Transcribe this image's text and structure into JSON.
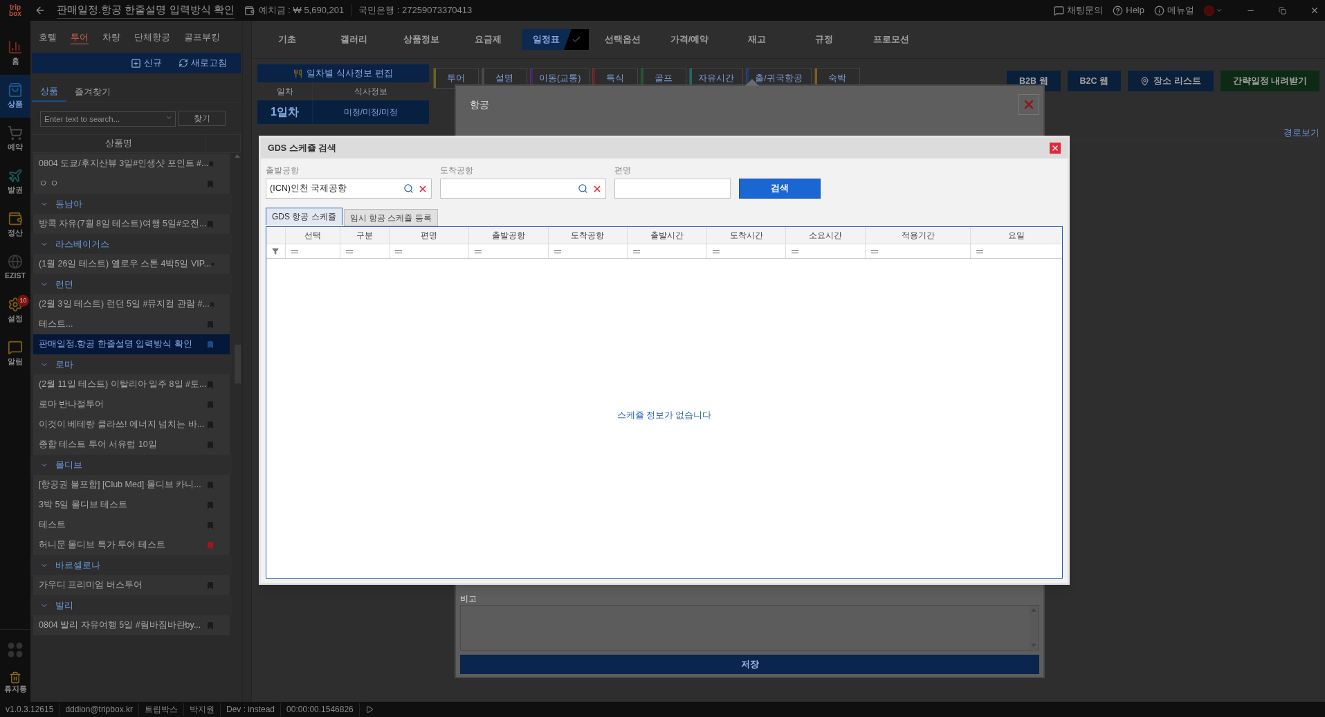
{
  "title_bar": {
    "logo": [
      "trip",
      "box"
    ],
    "title": "판매일정.항공 한줄설명 입력방식 확인",
    "deposit": "예치금 : ₩ 5,690,201",
    "bank": "국민은행 : 27259073370413",
    "links": [
      {
        "kind": "chat",
        "label": "채팅문의"
      },
      {
        "kind": "help",
        "label": "Help"
      },
      {
        "kind": "info",
        "label": "메뉴얼"
      }
    ]
  },
  "rail": {
    "items": [
      {
        "kind": "chart",
        "label": "홈",
        "selected": false
      },
      {
        "kind": "bag",
        "label": "상품",
        "selected": true
      },
      {
        "kind": "cart",
        "label": "예약",
        "selected": false
      },
      {
        "kind": "plane",
        "label": "발권",
        "selected": false
      },
      {
        "kind": "wallet",
        "label": "정산",
        "selected": false
      },
      {
        "kind": "globe",
        "label": "EZIST",
        "selected": false
      },
      {
        "kind": "gear",
        "label": "설정",
        "selected": false,
        "badge": "10"
      },
      {
        "kind": "chat",
        "label": "알림",
        "selected": false
      }
    ],
    "trash": "휴지통"
  },
  "sidebar": {
    "categories": [
      {
        "label": "호텔",
        "selected": false
      },
      {
        "label": "투어",
        "selected": true
      },
      {
        "label": "차량",
        "selected": false
      },
      {
        "label": "단체항공",
        "selected": false
      },
      {
        "label": "골프부킹",
        "selected": false
      }
    ],
    "actions": [
      "신규",
      "새로고침"
    ],
    "tabs": [
      {
        "label": "상품",
        "selected": true
      },
      {
        "label": "즐겨찾기",
        "selected": false
      }
    ],
    "search": {
      "placeholder": "Enter text to search...",
      "button": "찾기"
    },
    "column": "상품명",
    "items": [
      {
        "kind": "item",
        "label": "0804 도쿄/후지산뷰 3일#인생샷 포인트 #...",
        "selected": false,
        "bookmarked": false
      },
      {
        "kind": "item",
        "label": "ㅇ ㅇ",
        "selected": false,
        "bookmarked": false
      },
      {
        "kind": "group",
        "label": "동남아",
        "expanded": true,
        "children": [
          {
            "kind": "item",
            "label": "방콕 자유(7월 8일 테스트)여행 5일#오전...",
            "selected": false,
            "bookmarked": false
          }
        ]
      },
      {
        "kind": "group",
        "label": "라스베이거스",
        "expanded": true,
        "children": [
          {
            "kind": "item",
            "label": "(1월 26일 테스트) 옐로우 스톤 4박5일 VIP...",
            "selected": false,
            "bookmarked": false
          }
        ]
      },
      {
        "kind": "group",
        "label": "런던",
        "expanded": true,
        "children": [
          {
            "kind": "item",
            "label": "(2월 3일 테스트) 런던 5일 #뮤지컬 관람 #...",
            "selected": false,
            "bookmarked": false
          },
          {
            "kind": "item",
            "label": "테스트...",
            "selected": false,
            "bookmarked": false
          },
          {
            "kind": "item",
            "label": "판매일정.항공 한줄설명 입력방식 확인",
            "selected": true,
            "bookmarked": false
          }
        ]
      },
      {
        "kind": "group",
        "label": "로마",
        "expanded": true,
        "children": [
          {
            "kind": "item",
            "label": "(2월 11일 테스트) 이탈리아 일주 8일 #토...",
            "selected": false,
            "bookmarked": false
          },
          {
            "kind": "item",
            "label": "로마 반나절투어",
            "selected": false,
            "bookmarked": false
          },
          {
            "kind": "item",
            "label": "이것이 베테랑 클라쓰! 에너지 넘치는 바...",
            "selected": false,
            "bookmarked": false
          },
          {
            "kind": "item",
            "label": "종합 테스트 투어 서유럽 10일",
            "selected": false,
            "bookmarked": false
          }
        ]
      },
      {
        "kind": "group",
        "label": "몰디브",
        "expanded": true,
        "children": [
          {
            "kind": "item",
            "label": "[항공권 불포함] [Club Med] 몰디브 카니...",
            "selected": false,
            "bookmarked": false
          },
          {
            "kind": "item",
            "label": "3박 5일 몰디브 테스트",
            "selected": false,
            "bookmarked": false
          },
          {
            "kind": "item",
            "label": "테스트",
            "selected": false,
            "bookmarked": false
          },
          {
            "kind": "item",
            "label": "허니문 몰디브 특가 투어 테스트",
            "selected": false,
            "bookmarked": true
          }
        ]
      },
      {
        "kind": "group",
        "label": "바르셀로나",
        "expanded": true,
        "children": [
          {
            "kind": "item",
            "label": "가우디 프리미엄 버스투어",
            "selected": false,
            "bookmarked": false
          }
        ]
      },
      {
        "kind": "group",
        "label": "발리",
        "expanded": true,
        "children": [
          {
            "kind": "item",
            "label": "0804 발리 자유여행 5일 #림바짐바란by...",
            "selected": false,
            "bookmarked": false
          }
        ]
      }
    ]
  },
  "main_tabs": [
    {
      "label": "기초",
      "selected": false
    },
    {
      "label": "갤러리",
      "selected": false
    },
    {
      "label": "상품정보",
      "selected": false
    },
    {
      "label": "요금제",
      "selected": false
    },
    {
      "label": "일정표",
      "selected": true
    },
    {
      "label": "선택옵션",
      "selected": false
    },
    {
      "label": "가격/예약",
      "selected": false
    },
    {
      "label": "재고",
      "selected": false
    },
    {
      "label": "규정",
      "selected": false
    },
    {
      "label": "프로모션",
      "selected": false
    }
  ],
  "meals": {
    "button": "일차별 식사정보 편집",
    "columns": [
      "일차",
      "식사정보"
    ],
    "rows": [
      {
        "day": "1일차",
        "info": "미정/미정/미정"
      }
    ]
  },
  "schedule_types": [
    {
      "label": "투어",
      "color": "#6b6418"
    },
    {
      "label": "설명",
      "color": "#4a4a4a"
    },
    {
      "label": "이동(교통)",
      "color": "#4a2070"
    },
    {
      "label": "특식",
      "color": "#7a1c1c"
    },
    {
      "label": "골프",
      "color": "#1c5a30"
    },
    {
      "label": "자유시간",
      "color": "#1c6a6a"
    },
    {
      "label": "출/귀국항공",
      "color": "#1c3a7a"
    },
    {
      "label": "숙박",
      "color": "#8a5a10"
    }
  ],
  "toolbar": [
    {
      "kind": "plain",
      "label": "B2B 웹"
    },
    {
      "kind": "plain",
      "label": "B2C 웹"
    },
    {
      "kind": "place",
      "label": "장소 리스트"
    },
    {
      "kind": "download",
      "label": "간략일정 내려받기"
    }
  ],
  "route_link": "경로보기",
  "flight_panel": {
    "title": "항공",
    "note_label": "비고",
    "save": "저장"
  },
  "gds_dialog": {
    "title": "GDS 스케쥴 검색",
    "fields": [
      {
        "kind": "lookup",
        "label": "출발공항",
        "value": "(ICN)인천 국제공항"
      },
      {
        "kind": "lookup",
        "label": "도착공항"
      },
      {
        "kind": "text",
        "label": "편명"
      }
    ],
    "search": "검색",
    "tabs": [
      {
        "label": "GDS 항공 스케쥴",
        "selected": true
      },
      {
        "label": "임시 항공 스케쥴 등록",
        "selected": false
      }
    ],
    "columns": [
      "선택",
      "구분",
      "편명",
      "출발공항",
      "도착공항",
      "출발시간",
      "도착시간",
      "소요시간",
      "적용기간",
      "요일"
    ],
    "empty_message": "스케쥴 정보가 없습니다"
  },
  "status_bar": [
    "v1.0.3.12615",
    "dddion@tripbox.kr",
    "트립박스",
    "박지원",
    "Dev : instead",
    "00:00:00.1546826"
  ]
}
